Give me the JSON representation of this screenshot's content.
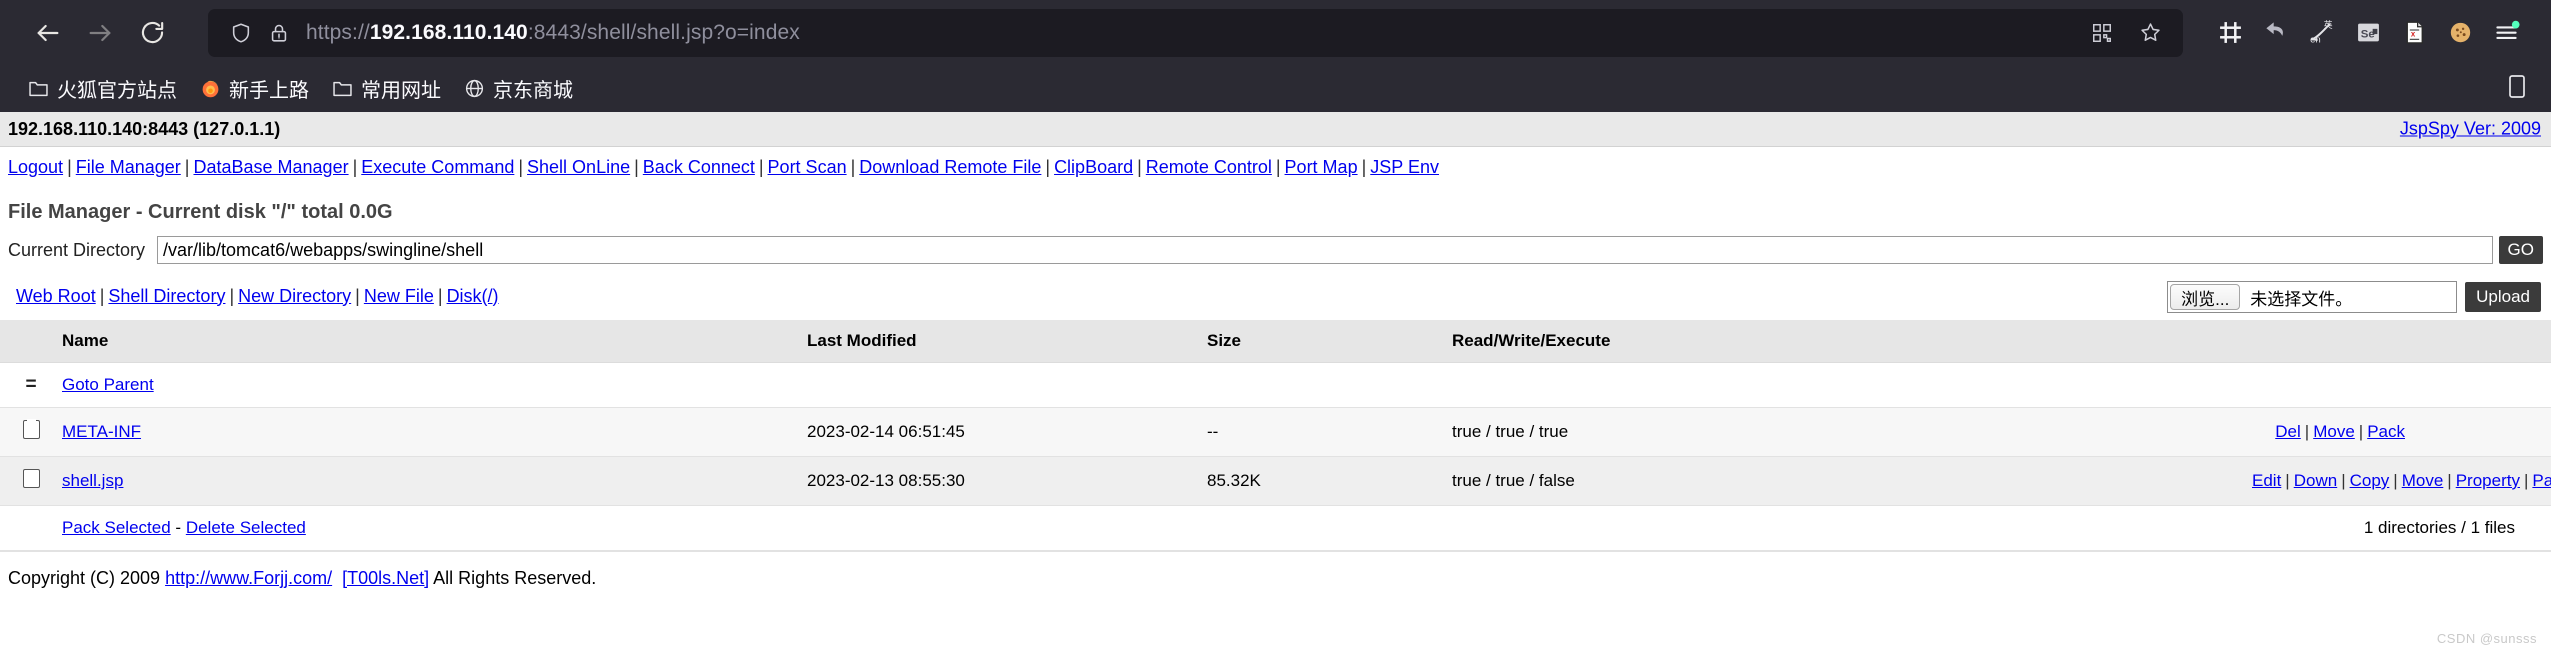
{
  "browser": {
    "nav": {
      "back": "back-arrow",
      "forward": "forward-arrow",
      "reload": "reload"
    },
    "url": {
      "scheme": "https://",
      "host": "192.168.110.140",
      "rest": ":8443/shell/shell.jsp?o=index",
      "full": "https://192.168.110.140:8443/shell/shell.jsp?o=index",
      "shield_icon": "tracking-shield-icon",
      "lock_icon": "insecure-lock-warning-icon",
      "qr_icon": "qr-code-icon",
      "bookmark_icon": "star-bookmark-icon"
    },
    "toolbar_icons": [
      "screenshot-crop-icon",
      "undo-arrow-icon",
      "translate-pen-icon",
      "selenium-recorder-icon",
      "xml-document-icon",
      "cookie-icon",
      "app-menu-icon"
    ],
    "bookmarks": [
      {
        "label": "火狐官方站点",
        "icon": "folder-icon"
      },
      {
        "label": "新手上路",
        "icon": "firefox-icon"
      },
      {
        "label": "常用网址",
        "icon": "folder-icon"
      },
      {
        "label": "京东商城",
        "icon": "globe-icon"
      }
    ],
    "bookmarks_right_icon": "mobile-bookmarks-icon"
  },
  "page": {
    "host_bar": {
      "host": "192.168.110.140:8443 (127.0.1.1)",
      "version_link": "JspSpy Ver: 2009"
    },
    "mainnav": [
      "Logout",
      "File Manager",
      "DataBase Manager",
      "Execute Command",
      "Shell OnLine",
      "Back Connect",
      "Port Scan",
      "Download Remote File",
      "ClipBoard",
      "Remote Control",
      "Port Map",
      "JSP Env"
    ],
    "title": "File Manager - Current disk \"/\" total 0.0G",
    "current_directory": {
      "label": "Current Directory",
      "value": "/var/lib/tomcat6/webapps/swingline/shell",
      "go_label": "GO"
    },
    "tools_links": [
      "Web Root",
      "Shell Directory",
      "New Directory",
      "New File",
      "Disk(/)"
    ],
    "upload": {
      "browse_label": "浏览...",
      "file_name": "未选择文件。",
      "upload_label": "Upload"
    },
    "table": {
      "headers": [
        "",
        "Name",
        "Last Modified",
        "Size",
        "Read/Write/Execute",
        ""
      ],
      "rows": [
        {
          "icon": "equals-icon",
          "name": "Goto Parent",
          "last_modified": "",
          "size": "",
          "rwx": "",
          "actions": []
        },
        {
          "icon": "folder-icon",
          "name": "META-INF",
          "last_modified": "2023-02-14 06:51:45",
          "size": "--",
          "rwx": "true / true / true",
          "actions": [
            "Del",
            "Move",
            "Pack"
          ]
        },
        {
          "icon": "checkbox-icon",
          "name": "shell.jsp",
          "last_modified": "2023-02-13 08:55:30",
          "size": "85.32K",
          "rwx": "true / true / false",
          "actions": [
            "Edit",
            "Down",
            "Copy",
            "Move",
            "Property",
            "Pack"
          ]
        }
      ],
      "footer": {
        "pack_selected": "Pack Selected",
        "separator": "-",
        "delete_selected": "Delete Selected",
        "count": "1 directories / 1 files"
      }
    },
    "copyright": {
      "prefix": "Copyright (C) 2009 ",
      "link1": "http://www.Forjj.com/",
      "link2": "[T00ls.Net]",
      "suffix": " All Rights Reserved."
    },
    "watermark": "CSDN @sunsss"
  },
  "colors": {
    "chrome_bg": "#2b2a33",
    "urlbar_bg": "#1c1b22",
    "link": "#0000ee",
    "header_bg": "#e6e6e6",
    "button_bg": "#3b3b3b"
  }
}
